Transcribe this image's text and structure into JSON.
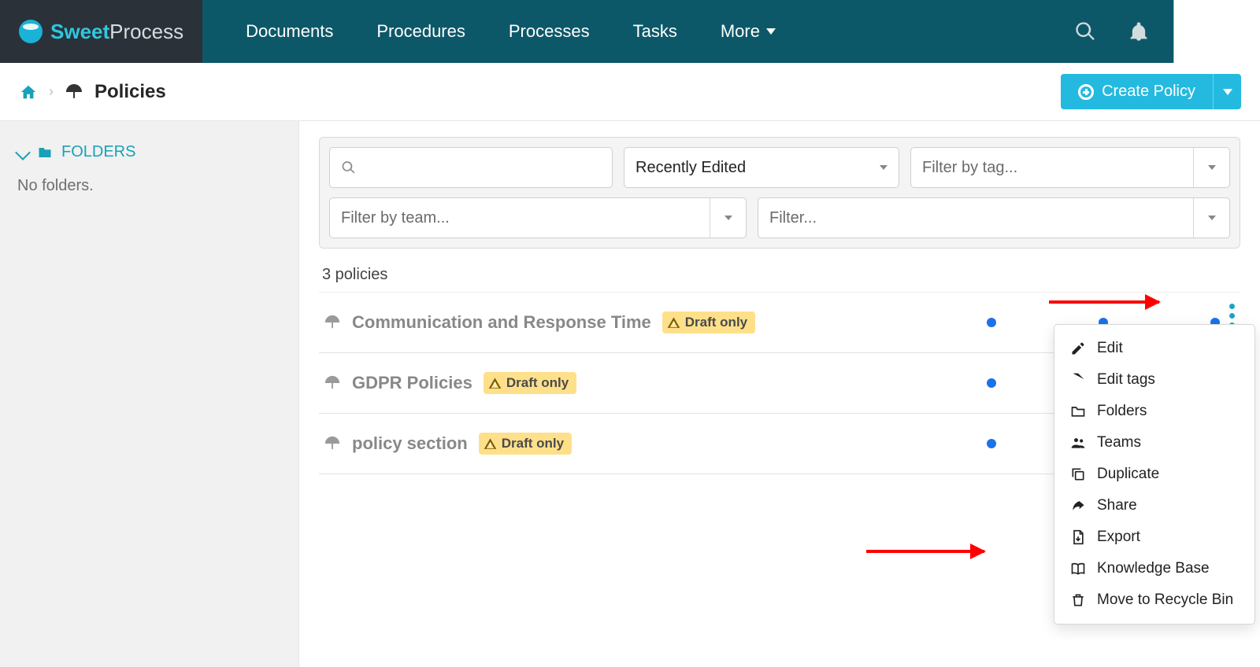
{
  "brand": {
    "text1": "Sweet",
    "text2": "Process"
  },
  "nav": {
    "documents": "Documents",
    "procedures": "Procedures",
    "processes": "Processes",
    "tasks": "Tasks",
    "more": "More"
  },
  "breadcrumb": {
    "label": "Policies"
  },
  "create_btn": "Create Policy",
  "sidebar": {
    "folders_header": "FOLDERS",
    "empty": "No folders."
  },
  "filters": {
    "sort": "Recently Edited",
    "tag_placeholder": "Filter by tag...",
    "team_placeholder": "Filter by team...",
    "filter2_placeholder": "Filter..."
  },
  "count": "3 policies",
  "badge": "Draft only",
  "policies": [
    {
      "title": "Communication and Response Time"
    },
    {
      "title": "GDPR Policies"
    },
    {
      "title": "policy section"
    }
  ],
  "menu": {
    "edit": "Edit",
    "edit_tags": "Edit tags",
    "folders": "Folders",
    "teams": "Teams",
    "duplicate": "Duplicate",
    "share": "Share",
    "export": "Export",
    "kb": "Knowledge Base",
    "recycle": "Move to Recycle Bin"
  }
}
